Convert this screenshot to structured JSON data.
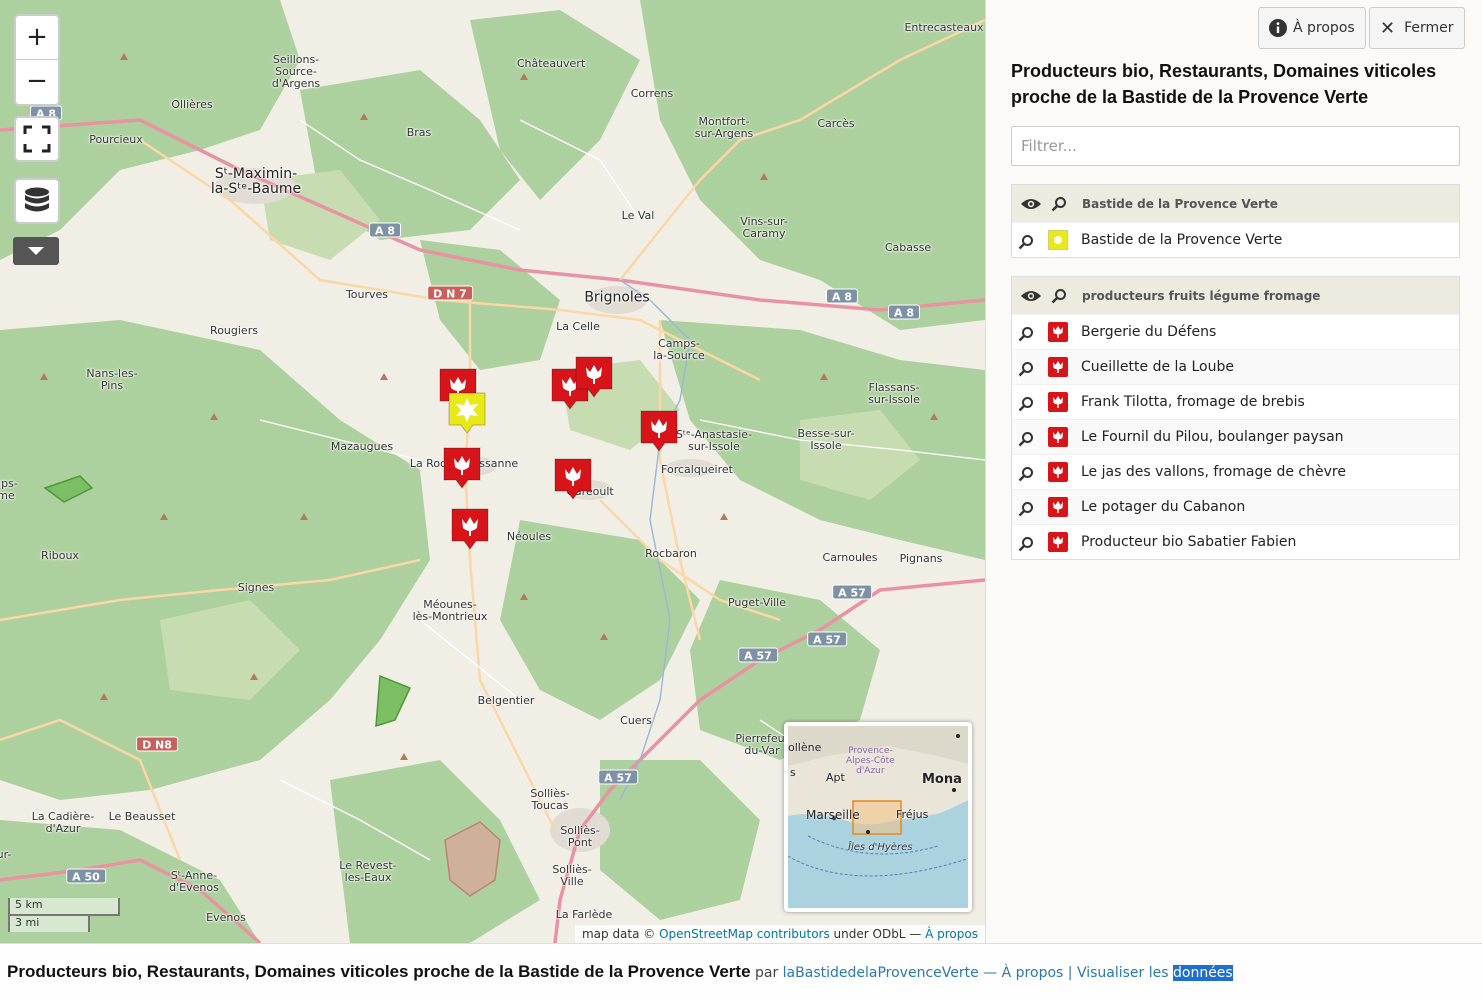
{
  "map": {
    "zoom_in_label": "+",
    "zoom_out_label": "−",
    "places": [
      {
        "name": "Seillons-\nSource-\nd'Argens",
        "big": false
      },
      {
        "name": "Châteauvert",
        "big": false
      },
      {
        "name": "Correns",
        "big": false
      },
      {
        "name": "Entrecasteaux",
        "big": false
      },
      {
        "name": "Ollières",
        "big": false
      },
      {
        "name": "Pourcieux",
        "big": false
      },
      {
        "name": "Bras",
        "big": false
      },
      {
        "name": "Montfort-\nsur-Argens",
        "big": false
      },
      {
        "name": "Carcès",
        "big": false
      },
      {
        "name": "Sᵗ-Maximin-\nla-Sᵗᵉ-Baume",
        "big": true
      },
      {
        "name": "Le Val",
        "big": false
      },
      {
        "name": "Vins-sur-\nCaramy",
        "big": false
      },
      {
        "name": "Cabasse",
        "big": false
      },
      {
        "name": "Tourves",
        "big": false
      },
      {
        "name": "Brignoles",
        "big": true
      },
      {
        "name": "La Celle",
        "big": false
      },
      {
        "name": "Camps-\nla-Source",
        "big": false
      },
      {
        "name": "Rougiers",
        "big": false
      },
      {
        "name": "Nans-les-\nPins",
        "big": false
      },
      {
        "name": "Flassans-\nsur-Issole",
        "big": false
      },
      {
        "name": "Mazaugues",
        "big": false
      },
      {
        "name": "Sᵗᵉ-Anastasie-\nsur-Issole",
        "big": false
      },
      {
        "name": "Besse-sur-\nIssole",
        "big": false
      },
      {
        "name": "La Roquebrussanne",
        "big": false
      },
      {
        "name": "Forcalqueiret",
        "big": false
      },
      {
        "name": "Garéoult",
        "big": false
      },
      {
        "name": "Néoules",
        "big": false
      },
      {
        "name": "Riboux",
        "big": false
      },
      {
        "name": "Rocbaron",
        "big": false
      },
      {
        "name": "Carnoules",
        "big": false
      },
      {
        "name": "Pignans",
        "big": false
      },
      {
        "name": "Signes",
        "big": false
      },
      {
        "name": "Puget-Ville",
        "big": false
      },
      {
        "name": "Méounes-\nlès-Montrieux",
        "big": false
      },
      {
        "name": "Belgentier",
        "big": false
      },
      {
        "name": "Cuers",
        "big": false
      },
      {
        "name": "Pierrefeu-\ndu-Var",
        "big": false
      },
      {
        "name": "Solliès-\nToucas",
        "big": false
      },
      {
        "name": "Solliès-\nPont",
        "big": false
      },
      {
        "name": "La Cadière-\nd'Azur",
        "big": false
      },
      {
        "name": "Le Beausset",
        "big": false
      },
      {
        "name": "Le Revest-\nles-Eaux",
        "big": false
      },
      {
        "name": "Sᵗ-Anne-\nd'Evenos",
        "big": false
      },
      {
        "name": "Solliès-\nVille",
        "big": false
      },
      {
        "name": "Evenos",
        "big": false
      },
      {
        "name": "La Farlède",
        "big": false
      },
      {
        "name": "ups-\nme",
        "big": false
      },
      {
        "name": "ur-",
        "big": false
      }
    ],
    "roads": [
      {
        "label": "A 8",
        "red": false
      },
      {
        "label": "A 8",
        "red": false
      },
      {
        "label": "A 8",
        "red": false
      },
      {
        "label": "A 8",
        "red": false
      },
      {
        "label": "D N 7",
        "red": true
      },
      {
        "label": "D N8",
        "red": true
      },
      {
        "label": "A 57",
        "red": false
      },
      {
        "label": "A 57",
        "red": false
      },
      {
        "label": "A 57",
        "red": false
      },
      {
        "label": "A 57",
        "red": false
      },
      {
        "label": "A 50",
        "red": false
      }
    ],
    "markers": [
      {
        "name": "Bastide de la Provence Verte",
        "color": "#e8e81a"
      },
      {
        "name": "Bergerie du Défens",
        "color": "#d7141a"
      },
      {
        "name": "Cueillette de la Loube",
        "color": "#d7141a"
      },
      {
        "name": "Frank Tilotta, fromage de brebis",
        "color": "#d7141a"
      },
      {
        "name": "Le Fournil du Pilou, boulanger paysan",
        "color": "#d7141a"
      },
      {
        "name": "Le jas des vallons, fromage de chèvre",
        "color": "#d7141a"
      },
      {
        "name": "Le potager du Cabanon",
        "color": "#d7141a"
      },
      {
        "name": "Producteur bio Sabatier Fabien",
        "color": "#d7141a"
      }
    ],
    "minimap": {
      "labels": [
        "ollène",
        "Provence-\nAlpes-Côte\nd'Azur",
        "Apt",
        "Mona",
        "Marseille",
        "Fréjus",
        "Îles d'Hyères",
        "s"
      ]
    },
    "scale": {
      "km": "5 km",
      "mi": "3 mi"
    },
    "attribution": {
      "prefix": "map data © ",
      "link": "OpenStreetMap contributors",
      "license": " under ODbL — ",
      "about": "À propos"
    }
  },
  "panel": {
    "about_button": "À propos",
    "close_button": "Fermer",
    "title": "Producteurs bio, Restaurants, Domaines viticoles proche de la Bastide de la Provence Verte",
    "filter_placeholder": "Filtrer...",
    "layers": [
      {
        "name": "Bastide de la Provence Verte",
        "items": [
          {
            "label": "Bastide de la Provence Verte",
            "color": "#e8e81a"
          }
        ]
      },
      {
        "name": "producteurs fruits légume fromage",
        "items": [
          {
            "label": "Bergerie du Défens",
            "color": "#d7141a"
          },
          {
            "label": "Cueillette de la Loube",
            "color": "#d7141a"
          },
          {
            "label": "Frank Tilotta, fromage de brebis",
            "color": "#d7141a"
          },
          {
            "label": "Le Fournil du Pilou, boulanger paysan",
            "color": "#d7141a"
          },
          {
            "label": "Le jas des vallons, fromage de chèvre",
            "color": "#d7141a"
          },
          {
            "label": "Le potager du Cabanon",
            "color": "#d7141a"
          },
          {
            "label": "Producteur bio Sabatier Fabien",
            "color": "#d7141a"
          }
        ]
      }
    ]
  },
  "footer": {
    "title": "Producteurs bio, Restaurants, Domaines viticoles proche de la Bastide de la Provence Verte",
    "by": " par ",
    "author": "laBastidedelaProvenceVerte",
    "sep1": " — ",
    "about": "À propos",
    "sep2": " | ",
    "view": "Visualiser les ",
    "data": "données"
  }
}
